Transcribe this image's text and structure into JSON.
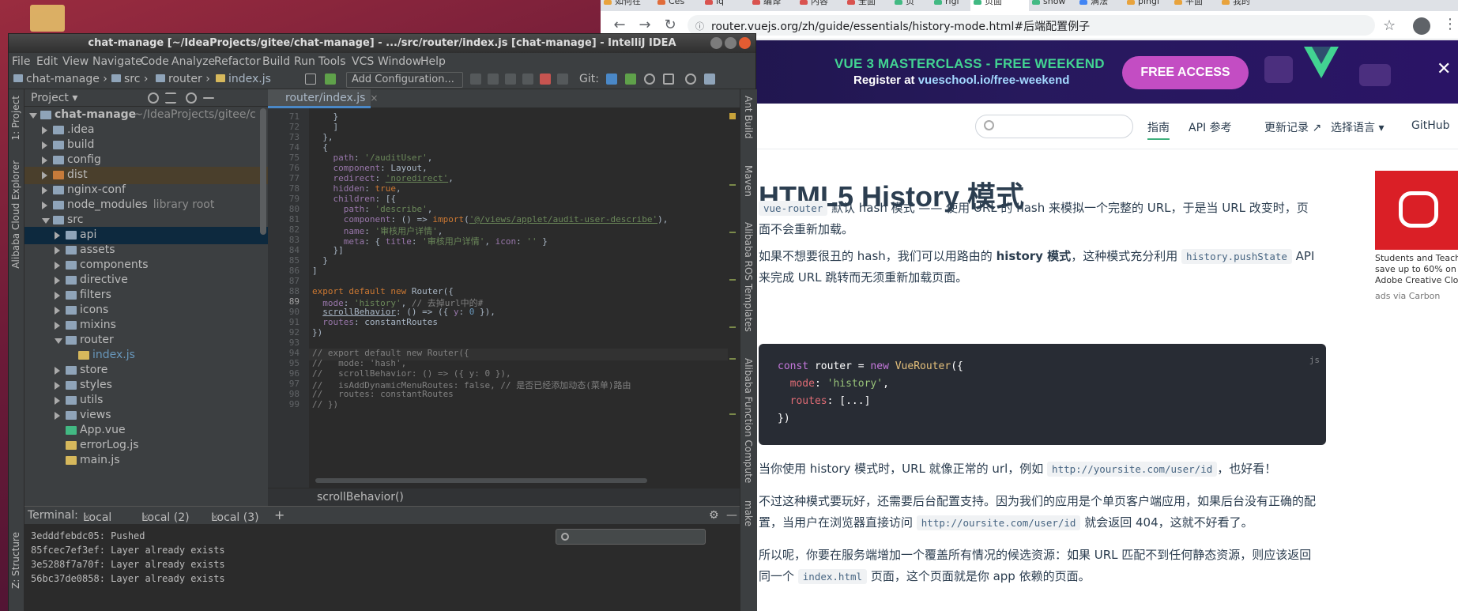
{
  "chrome": {
    "tabs": [
      "如何在",
      "Ces",
      "iq",
      "编译",
      "内容",
      "全面",
      "页",
      "rigi",
      "页面",
      "show",
      "满法",
      "pingi",
      "平面",
      "我的"
    ],
    "url": "router.vuejs.org/zh/guide/essentials/history-mode.html#后端配置例子",
    "back": "←",
    "forward": "→",
    "reload": "↻",
    "lock": "ⓘ",
    "star": "☆",
    "menu": "⋮"
  },
  "banner": {
    "title": "VUE 3 MASTERCLASS - FREE WEEKEND",
    "sub_prefix": "Register at ",
    "sub_link": "vueschool.io/free-weekend",
    "button": "FREE ACCESS",
    "close": "✕"
  },
  "sitenav": {
    "links": [
      "指南",
      "API 参考",
      "更新记录 ↗",
      "选择语言 ▾",
      "GitHub"
    ]
  },
  "doc": {
    "title": "HTML5 History 模式",
    "p1_code": "vue-router",
    "p1_text": " 默认 hash 模式 —— 使用 URL 的 hash 来模拟一个完整的 URL，于是当 URL 改变时，页面不会重新加载。",
    "p2_a": "如果不想要很丑的 hash，我们可以用路由的 ",
    "p2_b": "history 模式",
    "p2_c": "，这种模式充分利用 ",
    "p2_code": "history.pushState",
    "p2_d": " API 来完成 URL 跳转而无须重新加载页面。",
    "code_lang": "js",
    "p3_a": "当你使用 history 模式时，URL 就像正常的 url，例如 ",
    "p3_code": "http://yoursite.com/user/id",
    "p3_b": "，也好看！",
    "p4_a": "不过这种模式要玩好，还需要后台配置支持。因为我们的应用是个单页客户端应用，如果后台没有正确的配置，当用户在浏览器直接访问 ",
    "p4_code": "http://oursite.com/user/id",
    "p4_b": " 就会返回 404，这就不好看了。",
    "p5_a": "所以呢，你要在服务端增加一个覆盖所有情况的候选资源：如果 URL 匹配不到任何静态资源，则应该返回同一个 ",
    "p5_code": "index.html",
    "p5_b": " 页面，这个页面就是你 app 依赖的页面。",
    "ad_lines": [
      "Students and Teach",
      "save up to 60% on",
      "Adobe Creative Clo"
    ],
    "ad_via": "ads via Carbon"
  },
  "idea": {
    "title": "chat-manage [~/IdeaProjects/gitee/chat-manage] - .../src/router/index.js [chat-manage] - IntelliJ IDEA",
    "menu": [
      "File",
      "Edit",
      "View",
      "Navigate",
      "Code",
      "Analyze",
      "Refactor",
      "Build",
      "Run",
      "Tools",
      "VCS",
      "Window",
      "Help"
    ],
    "breadcrumb": [
      "chat-manage",
      "src",
      "router",
      "index.js"
    ],
    "add_config": "Add Configuration...",
    "git_label": "Git:",
    "left_tools": [
      "1: Project",
      "Alibaba Cloud Explorer",
      "Z: Structure"
    ],
    "right_tools": [
      "Ant Build",
      "Maven",
      "Alibaba ROS Templates",
      "Alibaba Function Compute",
      "make"
    ],
    "project_header": "Project ▾",
    "tree": [
      {
        "label": "chat-manage",
        "extra": "~/IdeaProjects/gitee/c",
        "depth": 0,
        "open": true
      },
      {
        "label": ".idea",
        "depth": 1
      },
      {
        "label": "build",
        "depth": 1
      },
      {
        "label": "config",
        "depth": 1
      },
      {
        "label": "dist",
        "depth": 1,
        "hl": true
      },
      {
        "label": "nginx-conf",
        "depth": 1
      },
      {
        "label": "node_modules",
        "extra": "library root",
        "depth": 1
      },
      {
        "label": "src",
        "depth": 1,
        "open": true
      },
      {
        "label": "api",
        "depth": 2,
        "sel": true
      },
      {
        "label": "assets",
        "depth": 2
      },
      {
        "label": "components",
        "depth": 2
      },
      {
        "label": "directive",
        "depth": 2
      },
      {
        "label": "filters",
        "depth": 2
      },
      {
        "label": "icons",
        "depth": 2
      },
      {
        "label": "mixins",
        "depth": 2
      },
      {
        "label": "router",
        "depth": 2,
        "open": true
      },
      {
        "label": "index.js",
        "depth": 3,
        "file": true
      },
      {
        "label": "store",
        "depth": 2
      },
      {
        "label": "styles",
        "depth": 2
      },
      {
        "label": "utils",
        "depth": 2
      },
      {
        "label": "views",
        "depth": 2
      },
      {
        "label": "App.vue",
        "depth": 2,
        "file": true
      },
      {
        "label": "errorLog.js",
        "depth": 2,
        "file": true
      },
      {
        "label": "main.js",
        "depth": 2,
        "file": true
      }
    ],
    "editor_tab": "router/index.js",
    "editor_tab_close": "×",
    "line_numbers": [
      "71",
      "72",
      "73",
      "74",
      "75",
      "76",
      "77",
      "78",
      "79",
      "80",
      "81",
      "82",
      "83",
      "84",
      "85",
      "86",
      "87",
      "88",
      "89",
      "90",
      "91",
      "92",
      "93",
      "94",
      "95",
      "96",
      "97",
      "98",
      "99"
    ],
    "current_line": "89",
    "hint": "scrollBehavior()",
    "terminal_label": "Terminal:",
    "terminal_tabs": [
      "Local",
      "Local (2)",
      "Local (3)"
    ],
    "terminal_lines": [
      "3edddfebdc05: Pushed",
      "85fcec7ef3ef: Layer already exists",
      "3e5288f7a70f: Layer already exists",
      "56bc37de0858: Layer already exists"
    ]
  }
}
